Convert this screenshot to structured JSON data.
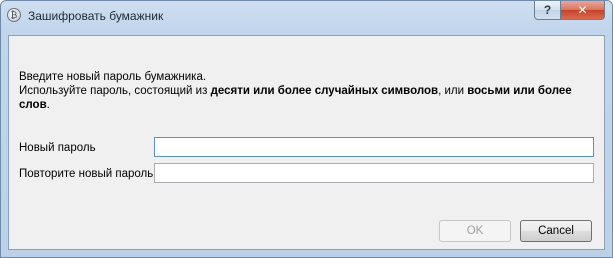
{
  "window": {
    "title": "Зашифровать бумажник",
    "help_label": "?",
    "close_label": "✕"
  },
  "warning": {
    "line1": "Введите новый пароль бумажника.",
    "line2_prefix": "Используйте пароль, состоящий из ",
    "line2_bold1": "десяти или более случайных символов",
    "line2_mid": ", или ",
    "line2_bold2": "восьми или более слов",
    "line2_suffix": "."
  },
  "form": {
    "new_password_label": "Новый пароль",
    "new_password_value": "",
    "repeat_password_label": "Повторите новый пароль",
    "repeat_password_value": ""
  },
  "buttons": {
    "ok_label": "OK",
    "ok_enabled": false,
    "cancel_label": "Cancel"
  },
  "icons": {
    "app_icon": "bitcoin-app-icon",
    "help": "help-icon",
    "close": "close-icon"
  }
}
